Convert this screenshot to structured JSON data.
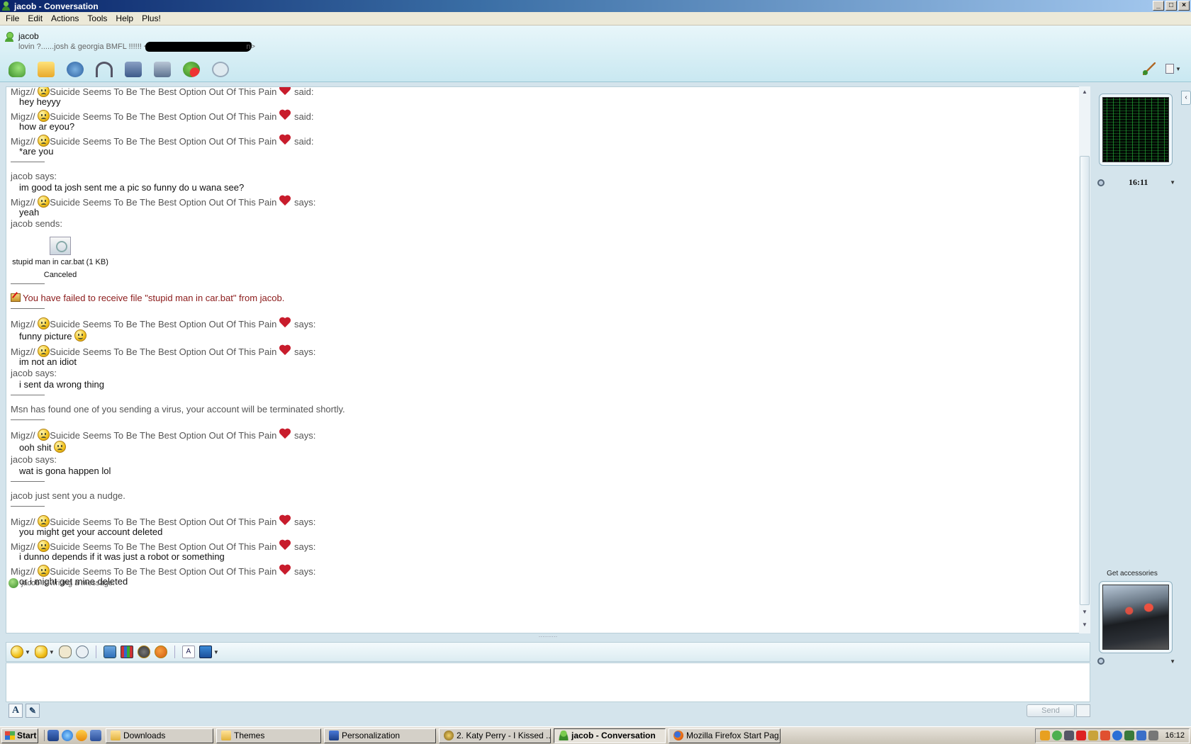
{
  "window": {
    "title": "jacob - Conversation",
    "min": "_",
    "max": "□",
    "close": "×"
  },
  "menu": [
    "File",
    "Edit",
    "Actions",
    "Tools",
    "Help",
    "Plus!"
  ],
  "contact": {
    "name": "jacob",
    "personal_message_start": "lovin ?......josh & georgia     BMFL !!!!!! <",
    "personal_message_end": "n>"
  },
  "messages": [
    {
      "kind": "header",
      "sender": "Migz// ",
      "nick": "Suicide Seems To Be The Best Option Out Of This Pain",
      "verb": " said:",
      "emoticon": "sad",
      "heart": true
    },
    {
      "kind": "text",
      "text": "hey heyyy"
    },
    {
      "kind": "header",
      "sender": "Migz// ",
      "nick": "Suicide Seems To Be The Best Option Out Of This Pain",
      "verb": " said:",
      "emoticon": "sad",
      "heart": true
    },
    {
      "kind": "text",
      "text": "how ar eyou?"
    },
    {
      "kind": "header",
      "sender": "Migz// ",
      "nick": "Suicide Seems To Be The Best Option Out Of This Pain",
      "verb": " said:",
      "emoticon": "sad",
      "heart": true
    },
    {
      "kind": "text",
      "text": "*are you"
    },
    {
      "kind": "sep"
    },
    {
      "kind": "plain",
      "text": "jacob says:"
    },
    {
      "kind": "text",
      "text": "im good ta josh sent me a pic so funny do u wana see?"
    },
    {
      "kind": "header",
      "sender": "Migz// ",
      "nick": "Suicide Seems To Be The Best Option Out Of This Pain",
      "verb": " says:",
      "emoticon": "sad",
      "heart": true
    },
    {
      "kind": "text",
      "text": "yeah"
    },
    {
      "kind": "plain",
      "text": "jacob sends:"
    },
    {
      "kind": "file",
      "name": "stupid man in car.bat (1 KB)",
      "status": "Canceled"
    },
    {
      "kind": "sep"
    },
    {
      "kind": "fail",
      "text": "You have failed to receive file \"stupid man in car.bat\" from jacob."
    },
    {
      "kind": "sep"
    },
    {
      "kind": "header",
      "sender": "Migz// ",
      "nick": "Suicide Seems To Be The Best Option Out Of This Pain",
      "verb": " says:",
      "emoticon": "sad",
      "heart": true
    },
    {
      "kind": "text",
      "text": "funny picture ",
      "emoticon": "happy"
    },
    {
      "kind": "header",
      "sender": "Migz// ",
      "nick": "Suicide Seems To Be The Best Option Out Of This Pain",
      "verb": " says:",
      "emoticon": "sad",
      "heart": true
    },
    {
      "kind": "text",
      "text": "im not an idiot"
    },
    {
      "kind": "plain",
      "text": "jacob says:"
    },
    {
      "kind": "text",
      "text": "i sent da wrong thing"
    },
    {
      "kind": "sep"
    },
    {
      "kind": "plain",
      "text": "Msn has found one of you sending a virus, your account will be terminated shortly."
    },
    {
      "kind": "sep"
    },
    {
      "kind": "header",
      "sender": "Migz// ",
      "nick": "Suicide Seems To Be The Best Option Out Of This Pain",
      "verb": " says:",
      "emoticon": "sad",
      "heart": true
    },
    {
      "kind": "text",
      "text": "ooh shit ",
      "emoticon": "sad"
    },
    {
      "kind": "plain",
      "text": "jacob says:"
    },
    {
      "kind": "text",
      "text": "wat is gona happen lol"
    },
    {
      "kind": "sep"
    },
    {
      "kind": "plain",
      "text": "jacob just sent you a nudge."
    },
    {
      "kind": "sep"
    },
    {
      "kind": "header",
      "sender": "Migz// ",
      "nick": "Suicide Seems To Be The Best Option Out Of This Pain",
      "verb": " says:",
      "emoticon": "sad",
      "heart": true
    },
    {
      "kind": "text",
      "text": "you might get your account deleted"
    },
    {
      "kind": "header",
      "sender": "Migz// ",
      "nick": "Suicide Seems To Be The Best Option Out Of This Pain",
      "verb": " says:",
      "emoticon": "sad",
      "heart": true
    },
    {
      "kind": "text",
      "text": "i dunno depends if it was just a robot or something"
    },
    {
      "kind": "header",
      "sender": "Migz// ",
      "nick": "Suicide Seems To Be The Best Option Out Of This Pain",
      "verb": " says:",
      "emoticon": "sad",
      "heart": true
    },
    {
      "kind": "text",
      "text": "or i might get mine deleted"
    }
  ],
  "typing_status": "jacob is writing a message.",
  "splitter": "··········",
  "compose": {
    "send_label": "Send",
    "font_label": "A"
  },
  "right_panel": {
    "clock": "16:11",
    "accessories_label": "Get accessories",
    "collapse": "‹"
  },
  "taskbar": {
    "start_label": "Start",
    "tasks": [
      {
        "label": "Downloads",
        "icon": "folder-icon",
        "active": false,
        "width": 152
      },
      {
        "label": "Themes",
        "icon": "folder-icon",
        "active": false,
        "width": 148
      },
      {
        "label": "Personalization",
        "icon": "monitor-icon",
        "active": false,
        "width": 158
      },
      {
        "label": "2. Katy Perry - I Kissed ...",
        "icon": "winamp-icon",
        "active": false,
        "width": 158
      },
      {
        "label": "jacob - Conversation",
        "icon": "person-icon",
        "active": true,
        "width": 158
      },
      {
        "label": "Mozilla Firefox Start Pag...",
        "icon": "firefox-icon",
        "active": false,
        "width": 158
      }
    ],
    "clock": "16:12"
  }
}
